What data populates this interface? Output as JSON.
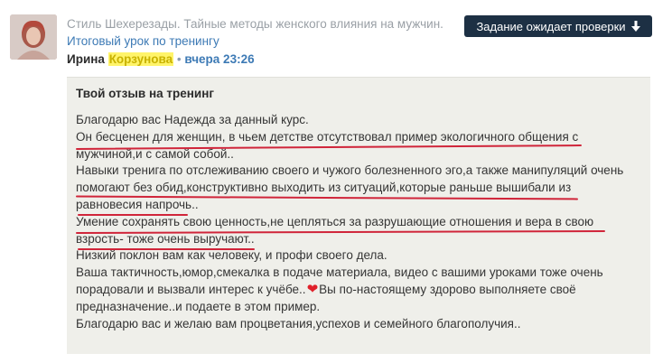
{
  "header": {
    "course_title": "Стиль Шехерезады. Тайные методы женского влияния на мужчин.",
    "lesson_link": "Итоговый урок по тренингу",
    "author_name": "Ирина",
    "author_surname": "Корзунова",
    "separator": "•",
    "time": "вчера 23:26",
    "status_button": "Задание ожидает проверки",
    "status_icon": "arrow-down-icon"
  },
  "review": {
    "heading": "Твой отзыв на тренинг",
    "lines": [
      "Благодарю вас Надежда за данный курс.",
      "Он бесценен для женщин, в чьем детстве отсутствовал пример экологичного общения с",
      "мужчиной,и с самой собой..",
      "Навыки тренига по отслеживанию своего и чужого болезненного эго,а также манипуляций очень",
      "помогают без обид,конструктивно выходить из ситуаций,которые раньше вышибали из",
      "равновесия напрочь..",
      "Умение сохранять свою ценность,не цепляться за разрушающие отношения и вера в свою",
      "взрость- тоже очень выручают..",
      "Низкий поклон вам как человеку, и профи своего дела.",
      "Ваша тактичность,юмор,смекалка в подаче материала, видео с вашими уроками тоже очень",
      "порадовали и вызвали интерес к учёбе..",
      "Вы по-настоящему здорово выполняете своё",
      "предназначение..и подаете в этом пример.",
      "Благодарю  вас и желаю вам процветания,успехов и семейного благополучия.."
    ],
    "heart_icon": "heart-emoji-icon"
  },
  "colors": {
    "panel_bg": "#efefea",
    "button_bg": "#1d3044",
    "link": "#3d7ab5",
    "underline": "#d0253a",
    "highlight": "#fff46a"
  }
}
